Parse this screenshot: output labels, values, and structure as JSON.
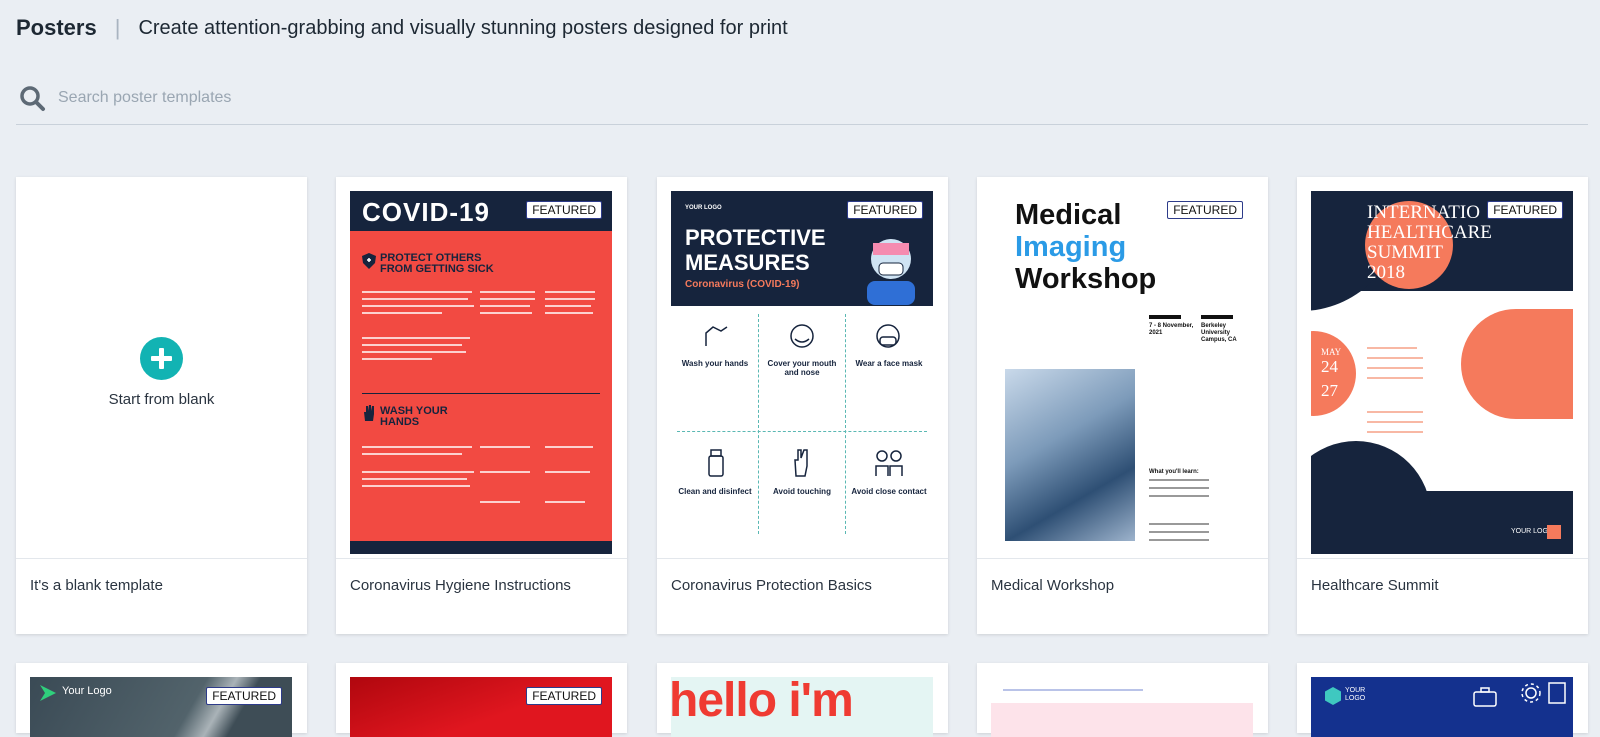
{
  "header": {
    "title": "Posters",
    "separator": "|",
    "subtitle": "Create attention-grabbing and visually stunning posters designed for print"
  },
  "search": {
    "placeholder": "Search poster templates",
    "icon": "search-icon"
  },
  "badge_label": "FEATURED",
  "cards": [
    {
      "label": "It's a blank template",
      "start_label": "Start from blank",
      "icon": "plus-icon"
    },
    {
      "label": "Coronavirus Hygiene Instructions",
      "featured": true
    },
    {
      "label": "Coronavirus Protection Basics",
      "featured": true
    },
    {
      "label": "Medical Workshop",
      "featured": true
    },
    {
      "label": "Healthcare Summit",
      "featured": true
    }
  ],
  "posters": {
    "covid": {
      "title": "COVID-19",
      "heading1": "PROTECT OTHERS FROM GETTING SICK",
      "heading2": "WASH YOUR HANDS"
    },
    "protective": {
      "logo": "YOUR LOGO",
      "title_line1": "PROTECTIVE",
      "title_line2": "MEASURES",
      "subtitle": "Coronavirus (COVID-19)",
      "cells": [
        "Wash your hands",
        "Cover your mouth and nose",
        "Wear a face mask",
        "Clean and disinfect",
        "Avoid touching",
        "Avoid close contact"
      ]
    },
    "medical": {
      "line1": "Medical",
      "line2": "Imaging",
      "line3": "Workshop",
      "date": "7 - 8 November, 2021",
      "venue": "Berkeley University Campus, CA",
      "learn": "What you'll learn:"
    },
    "summit": {
      "title_line1": "INTERNATIO",
      "title_line2": "HEALTHCARE",
      "title_line3": "SUMMIT",
      "year": "2018",
      "month": "MAY",
      "day1": "24",
      "day2": "27",
      "logo": "YOUR LOGO"
    }
  },
  "row2": [
    {
      "logo": "Your Logo",
      "featured": true
    },
    {
      "featured": true
    },
    {
      "text": "hello i'm"
    },
    {},
    {
      "logo": "YOUR LOGO"
    }
  ],
  "colors": {
    "accent_teal": "#12b3b3",
    "navy": "#16243d",
    "covid_red": "#f24a42",
    "coral": "#f57a5c",
    "page_bg": "#eaeef3"
  }
}
